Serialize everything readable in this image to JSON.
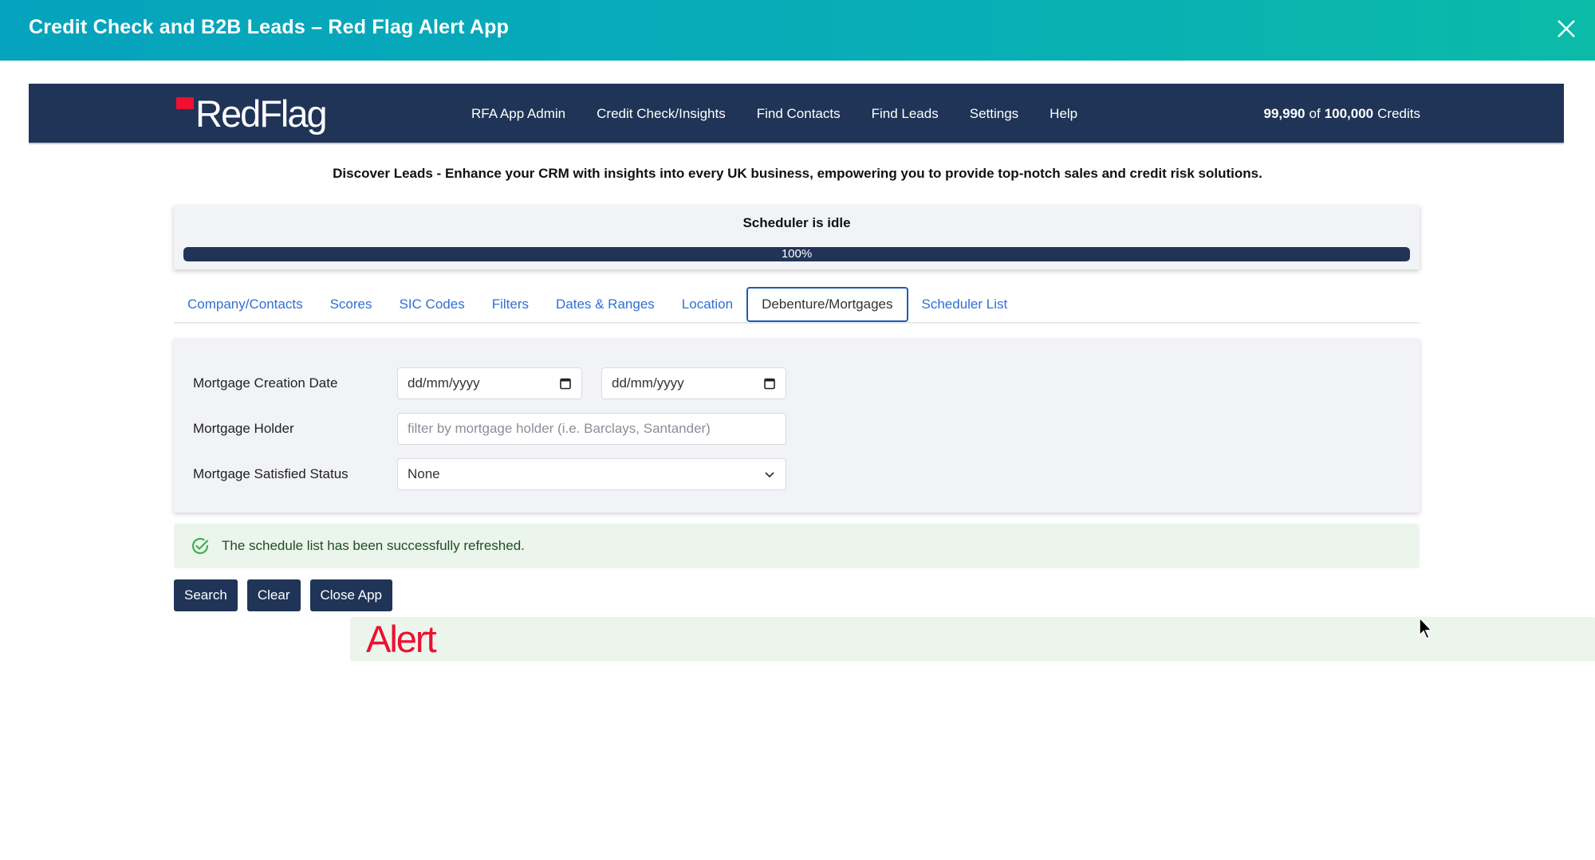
{
  "window": {
    "title": "Credit Check and B2B Leads – Red Flag Alert App",
    "close_icon": "close-icon"
  },
  "navbar": {
    "logo": {
      "part1": "RedFlag",
      "part2": "Alert"
    },
    "links": [
      "RFA App Admin",
      "Credit Check/Insights",
      "Find Contacts",
      "Find Leads",
      "Settings",
      "Help"
    ],
    "credits": {
      "used": "99,990",
      "of": "of",
      "total": "100,000",
      "label": "Credits"
    }
  },
  "tagline": "Discover Leads - Enhance your CRM with insights into every UK business, empowering you to provide top-notch sales and credit risk solutions.",
  "scheduler": {
    "status": "Scheduler is idle",
    "progress_percent": 100,
    "progress_label": "100%"
  },
  "tabs": [
    {
      "label": "Company/Contacts",
      "active": false
    },
    {
      "label": "Scores",
      "active": false
    },
    {
      "label": "SIC Codes",
      "active": false
    },
    {
      "label": "Filters",
      "active": false
    },
    {
      "label": "Dates & Ranges",
      "active": false
    },
    {
      "label": "Location",
      "active": false
    },
    {
      "label": "Debenture/Mortgages",
      "active": true
    },
    {
      "label": "Scheduler List",
      "active": false
    }
  ],
  "form": {
    "creation_date": {
      "label": "Mortgage Creation Date",
      "from_placeholder": "dd/mm/yyyy",
      "to_placeholder": "dd/mm/yyyy"
    },
    "holder": {
      "label": "Mortgage Holder",
      "placeholder": "filter by mortgage holder (i.e. Barclays, Santander)"
    },
    "satisfied_status": {
      "label": "Mortgage Satisfied Status",
      "value": "None"
    }
  },
  "alert": {
    "message": "The schedule list has been successfully refreshed."
  },
  "buttons": {
    "search": "Search",
    "clear": "Clear",
    "close_app": "Close App"
  },
  "colors": {
    "navy": "#1f3456",
    "teal": "#08aeb6",
    "brand_red": "#ef0f30",
    "link_blue": "#2f6fd6",
    "success_bg": "#ebf5ec"
  }
}
